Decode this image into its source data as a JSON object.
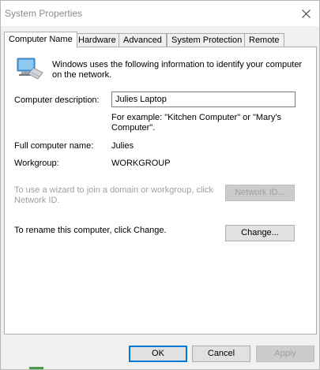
{
  "window": {
    "title": "System Properties"
  },
  "tabs": [
    {
      "label": "Computer Name",
      "active": true
    },
    {
      "label": "Hardware",
      "active": false
    },
    {
      "label": "Advanced",
      "active": false
    },
    {
      "label": "System Protection",
      "active": false
    },
    {
      "label": "Remote",
      "active": false
    }
  ],
  "computer_name": {
    "intro": "Windows uses the following information to identify your computer on the network.",
    "description_label": "Computer description:",
    "description_value": "Julies Laptop",
    "example": "For example: \"Kitchen Computer\" or \"Mary's Computer\".",
    "full_name_label": "Full computer name:",
    "full_name_value": "Julies",
    "workgroup_label": "Workgroup:",
    "workgroup_value": "WORKGROUP",
    "network_id_text": "To use a wizard to join a domain or workgroup, click Network ID.",
    "network_id_button": "Network ID...",
    "rename_text": "To rename this computer, click Change.",
    "change_button": "Change..."
  },
  "footer": {
    "ok": "OK",
    "cancel": "Cancel",
    "apply": "Apply"
  },
  "colors": {
    "accent": "#0078d7",
    "disabled_text": "#a0a0a0",
    "dialog_bg": "#f0f0f0"
  }
}
